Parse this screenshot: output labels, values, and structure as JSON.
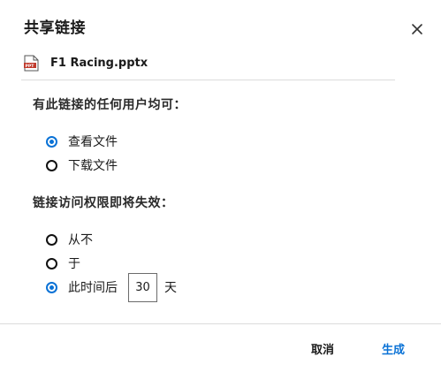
{
  "dialog": {
    "title": "共享链接",
    "close_icon": "close-icon"
  },
  "file": {
    "icon": "pptx-file-icon",
    "icon_text": "PPT",
    "name": "F1 Racing.pptx"
  },
  "access": {
    "label": "有此链接的任何用户均可：",
    "options": [
      {
        "label": "查看文件",
        "checked": true
      },
      {
        "label": "下载文件",
        "checked": false
      }
    ]
  },
  "expiry": {
    "label": "链接访问权限即将失效：",
    "options": [
      {
        "label": "从不",
        "checked": false
      },
      {
        "label": "于",
        "checked": false
      },
      {
        "label": "此时间后",
        "checked": true
      }
    ],
    "days_value": "30",
    "days_unit": "天"
  },
  "actions": {
    "cancel_label": "取消",
    "generate_label": "生成"
  },
  "colors": {
    "accent": "#0a72d6",
    "file_icon": "#c0392b"
  }
}
